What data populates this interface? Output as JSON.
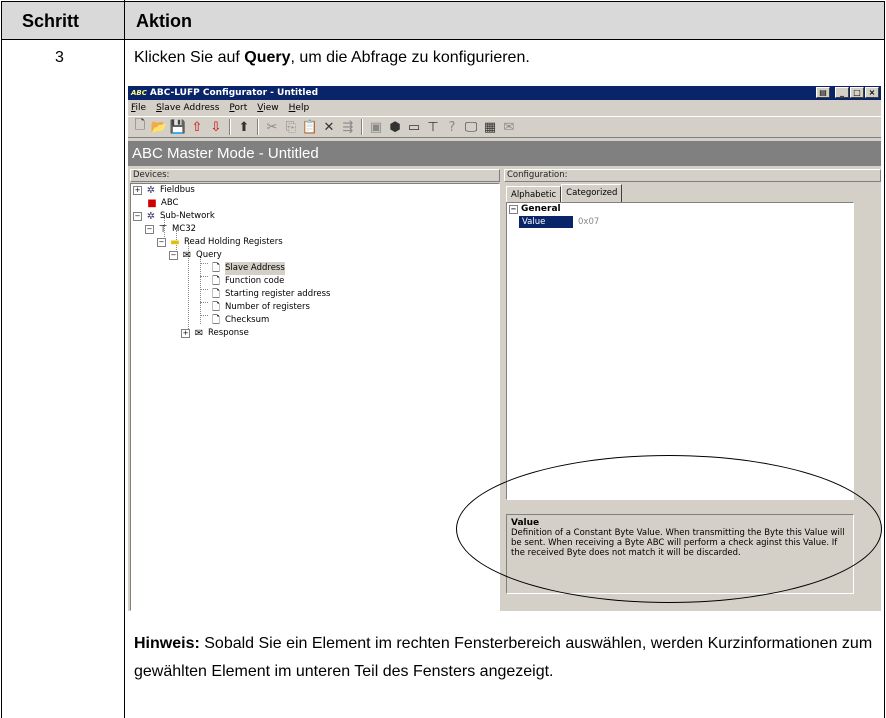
{
  "table": {
    "col1_header": "Schritt",
    "col2_header": "Aktion",
    "step_number": "3",
    "instruction_before": "Klicken Sie auf ",
    "instruction_bold": "Query",
    "instruction_after": ", um die Abfrage zu konfigurieren.",
    "note_label": "Hinweis:",
    "note_text": " Sobald Sie ein Element im rechten Fensterbereich auswählen, werden Kurzinformationen zum gewählten Element im unteren Teil des Fensters angezeigt."
  },
  "app": {
    "title": "ABC-LUFP Configurator - Untitled",
    "logo_text": "ABC",
    "menu": [
      "File",
      "Slave Address",
      "Port",
      "View",
      "Help"
    ],
    "toolbar_icons": [
      "new-icon",
      "open-icon",
      "save-icon",
      "upload-icon",
      "download-icon",
      "up-folder-icon",
      "cut-icon",
      "copy-icon",
      "paste-icon",
      "delete-icon",
      "insert-icon",
      "properties-icon",
      "node-icon",
      "monitor-icon",
      "filter-icon",
      "help-icon",
      "display-icon",
      "network-icon",
      "mail-icon"
    ],
    "mode_title": "ABC Master Mode - Untitled",
    "devices_label": "Devices:",
    "configuration_label": "Configuration:",
    "tabs": [
      "Alphabetic",
      "Categorized"
    ],
    "tree": {
      "fieldbus": "Fieldbus",
      "abc": "ABC",
      "subnetwork": "Sub-Network",
      "mc32": "MC32",
      "read_holding": "Read Holding Registers",
      "query": "Query",
      "slave_address": "Slave Address",
      "function_code": "Function code",
      "starting_register": "Starting register address",
      "number_registers": "Number of registers",
      "checksum": "Checksum",
      "response": "Response"
    },
    "property_category": "General",
    "property_name": "Value",
    "property_value": "0x07",
    "desc_title": "Value",
    "desc_text": "Definition of a Constant Byte Value. When transmitting the Byte this Value will be sent. When receiving a Byte ABC will perform a check aginst this Value. If the received Byte does not match it will be discarded."
  }
}
